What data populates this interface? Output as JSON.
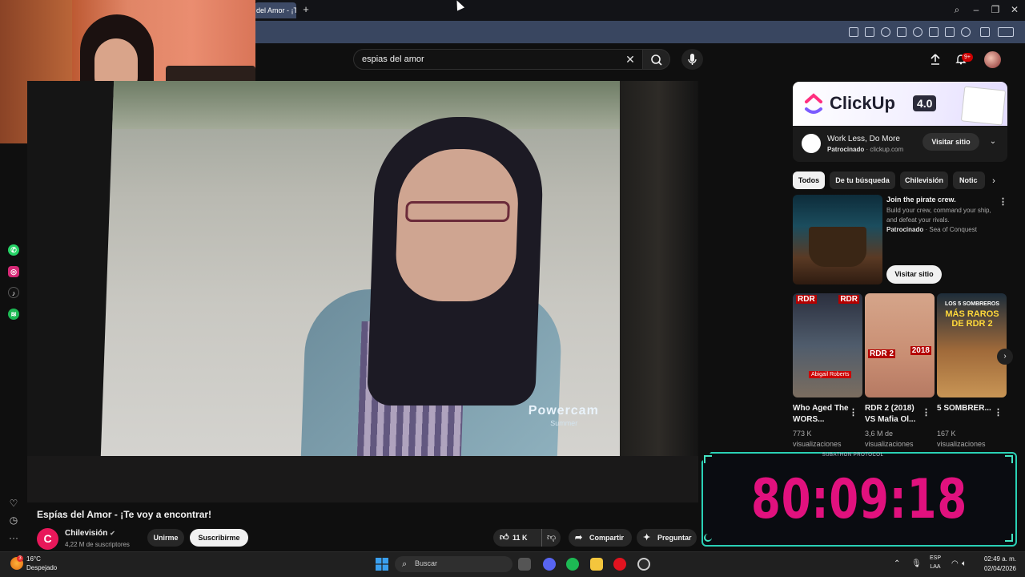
{
  "browser": {
    "tab_title": "del Amor - ¡T",
    "new_tab_icon": "plus-icon"
  },
  "search": {
    "value": "espias del amor",
    "notification_count": "9+"
  },
  "video": {
    "title": "Espías del Amor - ¡Te voy a encontrar!",
    "overlay_brand": "Powercam",
    "overlay_sub": "Summer",
    "channel": {
      "name": "Chilevisión",
      "subscribers": "4,22 M de suscriptores",
      "avatar_letter": "C"
    },
    "join_label": "Unirme",
    "subscribe_label": "Suscribirme",
    "likes": "11 K",
    "share_label": "Compartir",
    "ask_label": "Preguntar"
  },
  "ad": {
    "brand": "ClickUp",
    "version": "4.0",
    "title": "Work Less, Do More",
    "sponsored": "Patrocinado",
    "domain": "· clickup.com",
    "visit_label": "Visitar sitio"
  },
  "chips": [
    "Todos",
    "De tu búsqueda",
    "Chilevisión",
    "Notic"
  ],
  "promo": {
    "title": "Join the pirate crew.",
    "description": "Build your crew, command your ship, and defeat your rivals.",
    "sponsored": "Patrocinado",
    "advertiser": "· Sea of Conquest",
    "visit_label": "Visitar sitio"
  },
  "shorts": [
    {
      "title": "Who Aged The WORS...",
      "views": "773 K visualizaciones",
      "badge_left": "RDR",
      "badge_right": "RDR",
      "tag": "Abigail Roberts"
    },
    {
      "title": "RDR 2 (2018) VS Mafia Ol...",
      "views": "3,6 M de visualizaciones",
      "badge_left": "RDR 2",
      "badge_right": "2018"
    },
    {
      "title": "5 SOMBRER...",
      "views": "167 K visualizaciones",
      "headline": "MÁS RAROS DE RDR 2",
      "headline_top": "LOS 5 SOMBREROS"
    }
  ],
  "subathon": {
    "label": "SUBATHON PROTOCOL",
    "timer": "80:09:18"
  },
  "taskbar": {
    "temperature": "16°C",
    "weather": "Despejado",
    "search_label": "Buscar",
    "lang_top": "ESP",
    "lang_bottom": "LAA",
    "time": "02:49 a. m.",
    "date": "02/04/2026",
    "weather_alert": "3"
  },
  "colors": {
    "yt_background": "#0f0f0f",
    "timer": "#e1117e",
    "widget_border": "#2ad1b6",
    "toolbar": "#394660"
  }
}
